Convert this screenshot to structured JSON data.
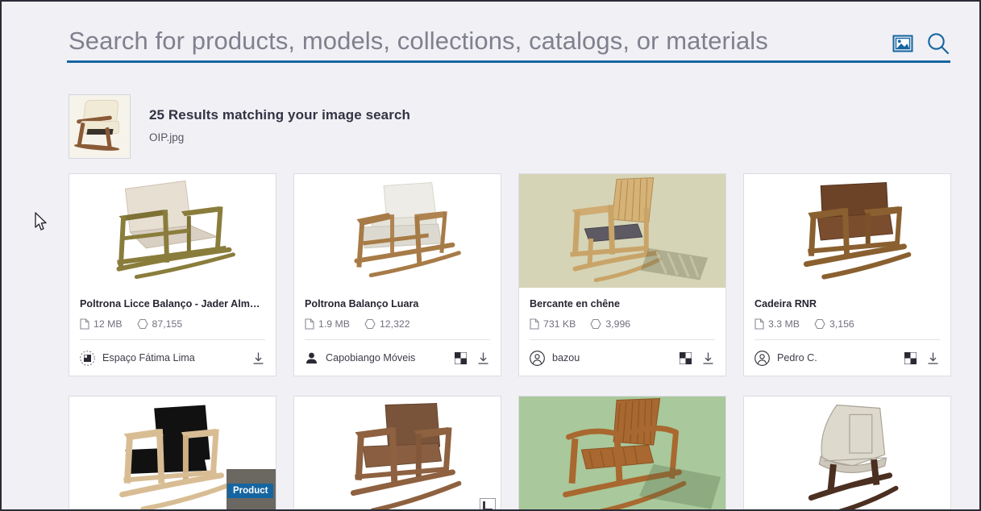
{
  "search": {
    "placeholder": "Search for products, models, collections, catalogs, or materials",
    "value": "",
    "image_search_icon": "image-search-icon",
    "search_icon": "search-icon",
    "underline_color": "#1565a0"
  },
  "results_header": {
    "count_text": "25 Results matching your image search",
    "filename": "OIP.jpg",
    "thumbnail_alt": "query-image-thumbnail"
  },
  "cards": [
    {
      "title": "Poltrona Licce Balanço - Jader Almei...",
      "size": "12 MB",
      "polycount": "87,155",
      "author": "Espaço Fátima Lima",
      "author_icon": "brand-avatar-icon",
      "has_texture_icon": false,
      "download_icon": "download-icon",
      "bg": "#ffffff"
    },
    {
      "title": "Poltrona Balanço Luara",
      "size": "1.9 MB",
      "polycount": "12,322",
      "author": "Capobiango Móveis",
      "author_icon": "person-icon",
      "has_texture_icon": true,
      "download_icon": "download-icon",
      "bg": "#ffffff"
    },
    {
      "title": "Bercante en chêne",
      "size": "731 KB",
      "polycount": "3,996",
      "author": "bazou",
      "author_icon": "user-circle-icon",
      "has_texture_icon": true,
      "download_icon": "download-icon",
      "bg": "#d6d4b6"
    },
    {
      "title": "Cadeira RNR",
      "size": "3.3 MB",
      "polycount": "3,156",
      "author": "Pedro C.",
      "author_icon": "user-circle-icon",
      "has_texture_icon": true,
      "download_icon": "download-icon",
      "bg": "#ffffff"
    },
    {
      "title": "",
      "size": "",
      "polycount": "",
      "author": "",
      "author_icon": "",
      "has_texture_icon": false,
      "download_icon": "",
      "bg": "#ffffff"
    },
    {
      "title": "",
      "size": "",
      "polycount": "",
      "author": "",
      "author_icon": "",
      "has_texture_icon": false,
      "download_icon": "",
      "bg": "#ffffff"
    },
    {
      "title": "",
      "size": "",
      "polycount": "",
      "author": "",
      "author_icon": "",
      "has_texture_icon": false,
      "download_icon": "",
      "bg": "#a9c89b"
    },
    {
      "title": "",
      "size": "",
      "polycount": "",
      "author": "",
      "author_icon": "",
      "has_texture_icon": false,
      "download_icon": "",
      "bg": "#ffffff"
    }
  ],
  "overlays": {
    "product_badge": "Product",
    "product_badge_color": "#1565a0",
    "corner_icon": "corner-crop-icon"
  },
  "colors": {
    "page_background": "#f0f0f5",
    "card_background": "#ffffff",
    "accent": "#1565a0",
    "text_primary": "#262634",
    "text_muted": "#70707e"
  }
}
